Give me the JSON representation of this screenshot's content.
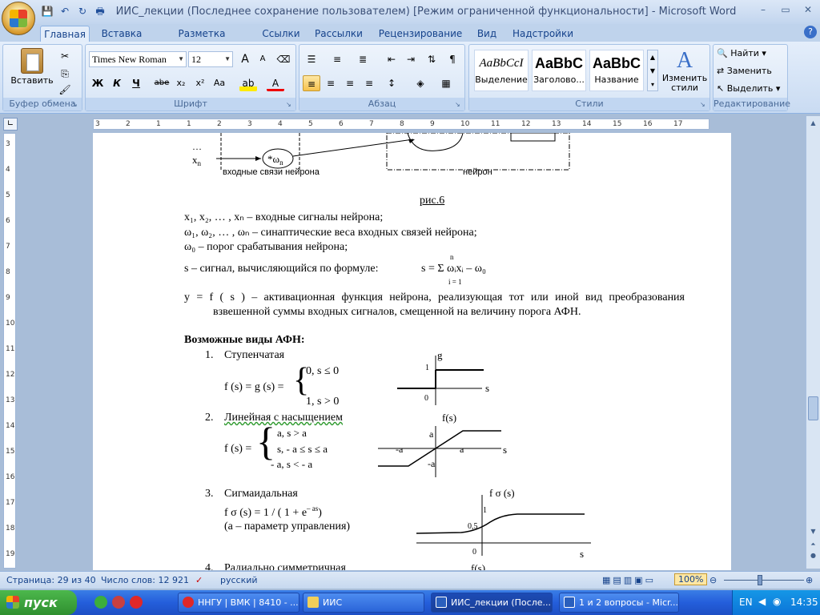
{
  "window": {
    "title": "ИИС_лекции (Последнее сохранение пользователем) [Режим ограниченной функциональности] - Microsoft Word",
    "minimize": "–",
    "restore": "▭",
    "close": "✕"
  },
  "qat": {
    "save_icon": "💾",
    "undo_icon": "↶",
    "redo_icon": "↻",
    "print_icon": "🖶"
  },
  "tabs": [
    "Главная",
    "Вставка",
    "Разметка страницы",
    "Ссылки",
    "Рассылки",
    "Рецензирование",
    "Вид",
    "Надстройки"
  ],
  "active_tab": "Главная",
  "ribbon": {
    "clipboard": {
      "label": "Буфер обмена",
      "paste": "Вставить"
    },
    "font": {
      "label": "Шрифт",
      "font_name": "Times New Roman",
      "font_size": "12",
      "bold": "Ж",
      "italic": "К",
      "underline": "Ч",
      "strike": "abe",
      "sub": "x₂",
      "sup": "x²",
      "case": "Aa",
      "grow": "A",
      "shrink": "A"
    },
    "paragraph": {
      "label": "Абзац"
    },
    "styles": {
      "label": "Стили",
      "cards": [
        {
          "sample": "AaBbCcI",
          "name": "Выделение"
        },
        {
          "sample": "AaBbC",
          "name": "Заголово..."
        },
        {
          "sample": "AaBbC",
          "name": "Название"
        }
      ],
      "change_styles": "Изменить стили"
    },
    "editing": {
      "label": "Редактирование",
      "find": "Найти",
      "replace": "Заменить",
      "select": "Выделить"
    }
  },
  "ruler": {
    "h_labels": [
      "3",
      "2",
      "1",
      "1",
      "2",
      "3",
      "4",
      "5",
      "6",
      "7",
      "8",
      "9",
      "10",
      "11",
      "12",
      "13",
      "14",
      "15",
      "16",
      "17"
    ],
    "v_labels": [
      "3",
      "4",
      "5",
      "6",
      "7",
      "8",
      "9",
      "10",
      "11",
      "12",
      "13",
      "14",
      "15",
      "16",
      "17",
      "18",
      "19"
    ]
  },
  "doc": {
    "fig_x": "x",
    "fig_xn_sub": "n",
    "fig_dots": "…",
    "fig_w": "*ω",
    "fig_w_sub": "n",
    "fig_inputs_label": "входные связи нейрона",
    "fig_neuron_label": "нейрон",
    "fig_caption": "рис.6",
    "line1": "x₁, x₂, … , xₙ – входные сигналы нейрона;",
    "line2": "ω₁, ω₂, … , ωₙ – синаптические веса входных связей нейрона;",
    "line3": "ω₀ – порог срабатывания нейрона;",
    "line4": "s – сигнал, вычисляющийся по формуле:",
    "formula": "s = Σ ωᵢxᵢ – ω₀",
    "formula_n": "n",
    "formula_i": "i = 1",
    "para_y": "y = f ( s ) – активационная функция нейрона, реализующая тот или иной вид преобразования взвешенной суммы входных сигналов, смещенной на величину порога АФН.",
    "heading": "Возможные виды АФН:",
    "items": [
      {
        "num": "1.",
        "name": "Ступенчатая"
      },
      {
        "num": "2.",
        "name": "Линейная с насыщением"
      },
      {
        "num": "3.",
        "name": "Сигмаидальная"
      },
      {
        "num": "4.",
        "name": "Радиально симметричная"
      }
    ],
    "step": {
      "lhs": "f (s) = g (s) =",
      "c1": "0,  s ≤ 0",
      "c2": "1,  s > 0",
      "g": "g",
      "one": "1",
      "zero": "0",
      "s": "s"
    },
    "lin": {
      "lhs": "f (s) =",
      "c1": "a,  s > a",
      "c2": "s,  - a ≤ s ≤ a",
      "c3": "- a,  s < - a",
      "fs": "f(s)",
      "a": "a",
      "ma": "-a",
      "s": "s"
    },
    "sig": {
      "fs": "f σ (s)",
      "f1": "f σ (s) = 1 / ( 1 + e",
      "exp": "– as",
      "f1b": ")",
      "f2": "(а – параметр управления)",
      "one": "1",
      "half": "0,5",
      "zero": "0",
      "s": "s"
    },
    "rad_fs": "f(s)"
  },
  "status": {
    "page": "Страница: 29 из 40",
    "words": "Число слов: 12 921",
    "lang": "русский",
    "zoom": "100%"
  },
  "taskbar": {
    "start": "пуск",
    "tasks": [
      "ННГУ | ВМК | 8410 - ...",
      "ИИС",
      "ИИС_лекции (После...",
      "1 и 2 вопросы - Micr..."
    ],
    "lang": "EN",
    "time": "14:35"
  }
}
